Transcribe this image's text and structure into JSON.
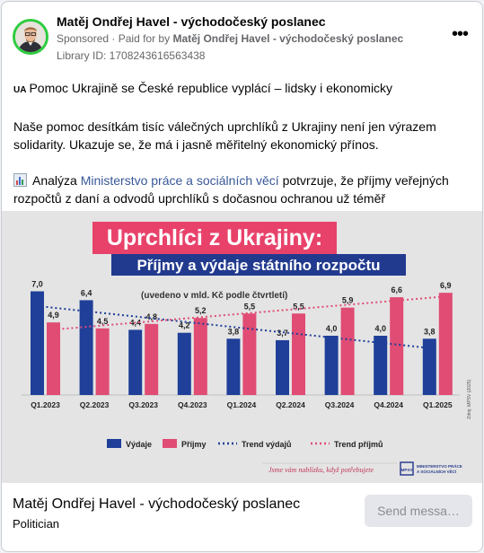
{
  "header": {
    "page_name": "Matěj Ondřej Havel - východočeský poslanec",
    "sponsored": "Sponsored",
    "paid_for_prefix": "Paid for by",
    "paid_for_name": "Matěj Ondřej Havel - východočeský poslanec",
    "library_id": "Library ID: 1708243616563438",
    "more_icon": "more-options-icon"
  },
  "post": {
    "flag_text": "UA",
    "line1": "Pomoc Ukrajině se České republice vyplácí – lidsky i ekonomicky",
    "para2": "Naše pomoc desítkám tisíc válečných uprchlíků z Ukrajiny není jen výrazem solidarity. Ukazuje se, že má i jasně měřitelný ekonomický přínos.",
    "para3_link": "Ministerstvo práce a sociálních věcí",
    "para3_prefix": "Analýza",
    "para3_rest": "potvrzuje, že příjmy veřejných rozpočtů z daní a odvodů uprchlíků s dočasnou ochranou už téměř dvojnásobně…"
  },
  "image": {
    "title": "Uprchlíci z Ukrajiny:",
    "subtitle": "Příjmy a výdaje státního rozpočtu",
    "note": "(uvedeno v mld. Kč podle čtvrtletí)",
    "source": "Zdroj: MPSV (2025)",
    "signature": "Jsme vám nablízku, když potřebujete",
    "ministry": "MINISTERSTVO PRÁCE A SOCIÁLNÍCH VĚCÍ",
    "logo_mark": "MPSV"
  },
  "chart_data": {
    "type": "bar",
    "categories": [
      "Q1.2023",
      "Q2.2023",
      "Q3.2023",
      "Q4.2023",
      "Q1.2024",
      "Q2.2024",
      "Q3.2024",
      "Q4.2024",
      "Q1.2025"
    ],
    "series": [
      {
        "name": "Výdaje",
        "values": [
          7.0,
          6.4,
          4.4,
          4.2,
          3.8,
          3.7,
          4.0,
          4.0,
          3.8
        ],
        "labels": [
          "7,0",
          "6,4",
          "4,4",
          "4,2",
          "3,8",
          "3,7",
          "4,0",
          "4,0",
          "3,8"
        ],
        "color": "#1f3f99"
      },
      {
        "name": "Příjmy",
        "values": [
          4.9,
          4.5,
          4.8,
          5.2,
          5.5,
          5.5,
          5.9,
          6.6,
          6.9
        ],
        "labels": [
          "4,9",
          "4,5",
          "4,8",
          "5,2",
          "5,5",
          "5,5",
          "5,9",
          "6,6",
          "6,9"
        ],
        "color": "#e04c74"
      }
    ],
    "legend": [
      "Výdaje",
      "Příjmy",
      "Trend výdajů",
      "Trend příjmů"
    ],
    "trend_colors": {
      "vydaje": "#1f3f99",
      "prijmy": "#e04c74"
    },
    "ylim": [
      0,
      8
    ],
    "legend_position": "bottom"
  },
  "footer": {
    "name": "Matěj Ondřej Havel - východočeský poslanec",
    "category": "Politician",
    "send_label": "Send messa…"
  }
}
